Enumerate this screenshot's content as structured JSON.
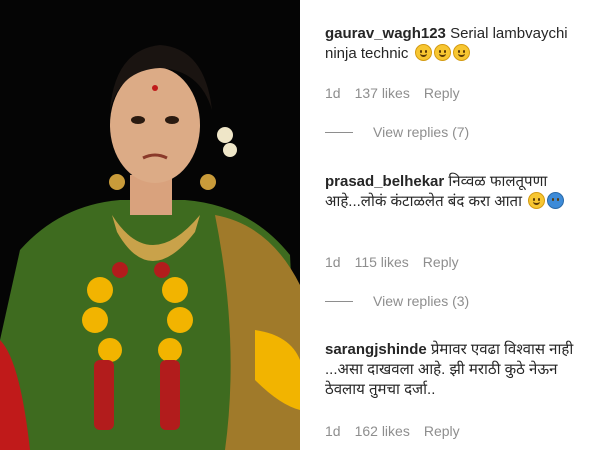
{
  "comments": [
    {
      "username": "gaurav_wagh123",
      "text": "Serial lambvaychi ninja technic",
      "emojis": [
        "grinning-squint-face",
        "tears-of-joy-face",
        "smiling-face"
      ],
      "time": "1d",
      "likes": "137 likes",
      "reply_label": "Reply",
      "view_replies": "View replies (7)"
    },
    {
      "username": "prasad_belhekar",
      "text": "निव्वळ फालतूपणा आहे...लोकं कंटाळलेत बंद करा आता",
      "emojis": [
        "rolling-eyes-face",
        "folded-hands"
      ],
      "time": "1d",
      "likes": "115 likes",
      "reply_label": "Reply",
      "view_replies": "View replies (3)"
    },
    {
      "username": "sarangjshinde",
      "text": "प्रेमावर एवढा विश्वास नाही ...असा दाखवला आहे. झी मराठी कुठे नेऊन ठेवलाय तुमचा दर्जा..",
      "emojis": [],
      "time": "1d",
      "likes": "162 likes",
      "reply_label": "Reply"
    }
  ],
  "colors": {
    "text": "#262626",
    "meta": "#8e8e8e",
    "saree_green": "#3e6b1f",
    "saree_red": "#c01a1a",
    "marigold": "#f2b400"
  }
}
